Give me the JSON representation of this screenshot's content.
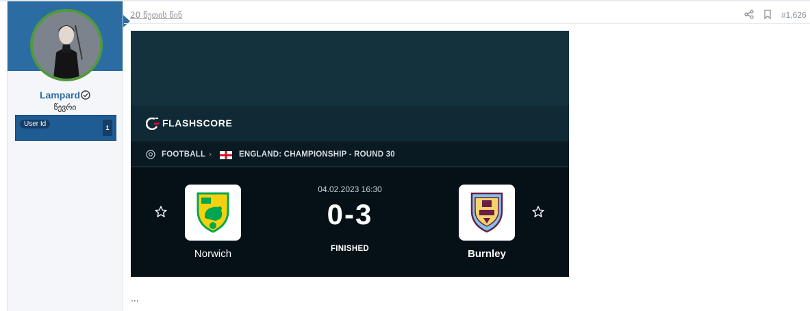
{
  "user": {
    "name": "Lampard",
    "title": "წევრი",
    "id_label": "User Id",
    "id_value": "1"
  },
  "post": {
    "date": "20 წუთის წინ",
    "number": "#1,626",
    "trailing_text": "..."
  },
  "embed": {
    "brand": "FLASHSCORE",
    "sport": "FOOTBALL",
    "league": "ENGLAND: CHAMPIONSHIP - ROUND 30",
    "datetime": "04.02.2023 16:30",
    "score": "0-3",
    "status": "FINISHED",
    "home_team": "Norwich",
    "away_team": "Burnley"
  },
  "icons": [
    "verified-icon",
    "share-icon",
    "bookmark-icon",
    "ball-icon",
    "flag-icon",
    "star-icon"
  ],
  "colors": {
    "accent": "#2b6ca3",
    "card_dark": "#0f2129",
    "card_teal": "#14323e",
    "norwich_yellow": "#f5d20d",
    "norwich_green": "#00a650",
    "burnley_claret": "#6c1d45",
    "burnley_blue": "#7fc3e8"
  }
}
